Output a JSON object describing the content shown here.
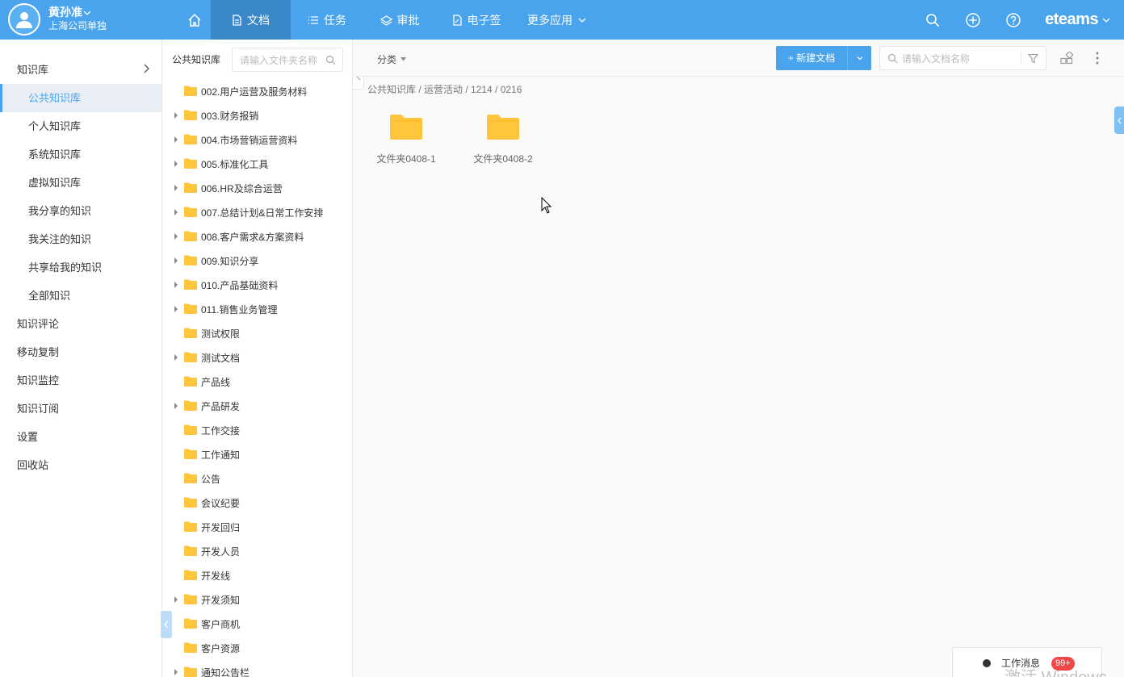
{
  "user": {
    "name": "黄孙准",
    "company": "上海公司单独"
  },
  "nav": {
    "items": [
      {
        "label": "文档",
        "active": true
      },
      {
        "label": "任务"
      },
      {
        "label": "审批"
      },
      {
        "label": "电子签"
      },
      {
        "label": "更多应用"
      }
    ],
    "brand": "eteams"
  },
  "sidebar": {
    "items": [
      {
        "label": "知识库"
      },
      {
        "label": "公共知识库",
        "active": true
      },
      {
        "label": "个人知识库"
      },
      {
        "label": "系统知识库"
      },
      {
        "label": "虚拟知识库"
      },
      {
        "label": "我分享的知识"
      },
      {
        "label": "我关注的知识"
      },
      {
        "label": "共享给我的知识"
      },
      {
        "label": "全部知识"
      },
      {
        "label": "知识评论"
      },
      {
        "label": "移动复制"
      },
      {
        "label": "知识监控"
      },
      {
        "label": "知识订阅"
      },
      {
        "label": "设置"
      },
      {
        "label": "回收站"
      }
    ]
  },
  "tree": {
    "title": "公共知识库",
    "search_placeholder": "请输入文件夹名称",
    "folders": [
      {
        "label": "002.用户运营及服务材料",
        "expandable": false
      },
      {
        "label": "003.财务报销",
        "expandable": true
      },
      {
        "label": "004.市场营销运营资料",
        "expandable": true
      },
      {
        "label": "005.标准化工具",
        "expandable": true
      },
      {
        "label": "006.HR及综合运营",
        "expandable": true
      },
      {
        "label": "007.总结计划&日常工作安排",
        "expandable": true
      },
      {
        "label": "008.客户需求&方案资料",
        "expandable": true
      },
      {
        "label": "009.知识分享",
        "expandable": true
      },
      {
        "label": "010.产品基础资料",
        "expandable": true
      },
      {
        "label": "011.销售业务管理",
        "expandable": true
      },
      {
        "label": "测试权限",
        "expandable": false
      },
      {
        "label": "测试文档",
        "expandable": true
      },
      {
        "label": "产品线",
        "expandable": false
      },
      {
        "label": "产品研发",
        "expandable": true
      },
      {
        "label": "工作交接",
        "expandable": false
      },
      {
        "label": "工作通知",
        "expandable": false
      },
      {
        "label": "公告",
        "expandable": false
      },
      {
        "label": "会议纪要",
        "expandable": false
      },
      {
        "label": "开发回归",
        "expandable": false
      },
      {
        "label": "开发人员",
        "expandable": false
      },
      {
        "label": "开发线",
        "expandable": false
      },
      {
        "label": "开发须知",
        "expandable": true
      },
      {
        "label": "客户商机",
        "expandable": false
      },
      {
        "label": "客户资源",
        "expandable": false
      },
      {
        "label": "通知公告栏",
        "expandable": true
      }
    ]
  },
  "main": {
    "category_label": "分类",
    "new_doc_label": "+ 新建文档",
    "search_placeholder": "请输入文档名称",
    "breadcrumb": "公共知识库 / 运营活动 / 1214 / 0216",
    "files": [
      {
        "name": "文件夹0408-1"
      },
      {
        "name": "文件夹0408-2"
      }
    ]
  },
  "messages": {
    "label": "工作消息",
    "badge": "99+"
  },
  "watermark": "激活 Windows",
  "colors": {
    "accent": "#4aa3ed",
    "folder": "#ffc53d",
    "badge": "#f04848"
  }
}
